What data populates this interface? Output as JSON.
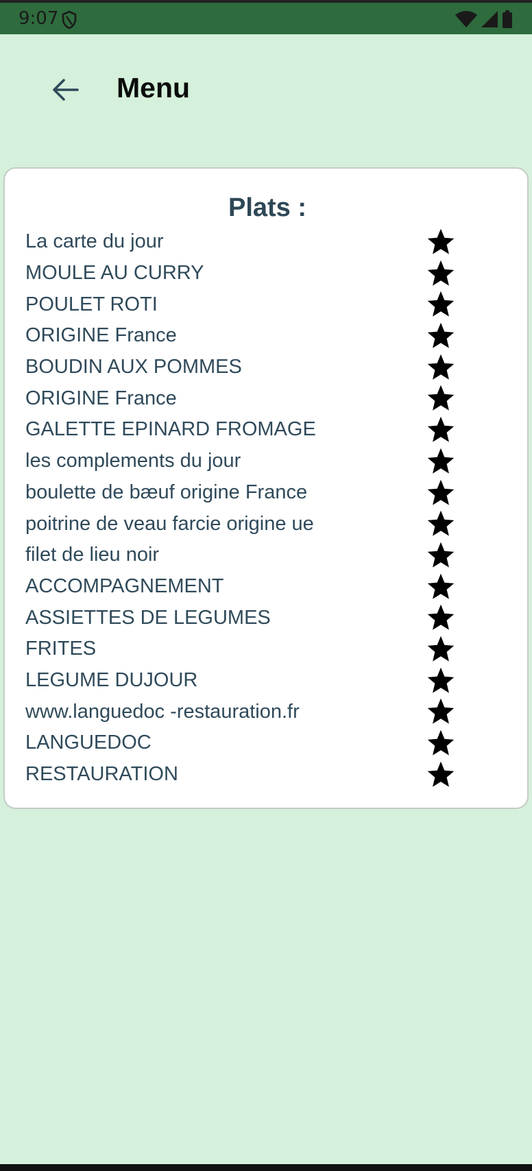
{
  "status_bar": {
    "time": "9:07",
    "icons": [
      "shield-icon",
      "wifi-icon",
      "cellular-signal-icon",
      "battery-icon"
    ]
  },
  "app_bar": {
    "back_icon": "arrow-back-icon",
    "title": "Menu"
  },
  "card": {
    "title": "Plats :",
    "items": [
      {
        "label": "La carte du jour"
      },
      {
        "label": "MOULE AU CURRY"
      },
      {
        "label": "POULET ROTI"
      },
      {
        "label": "ORIGINE France"
      },
      {
        "label": "BOUDIN AUX POMMES"
      },
      {
        "label": "ORIGINE France"
      },
      {
        "label": "GALETTE EPINARD FROMAGE"
      },
      {
        "label": "les complements du jour"
      },
      {
        "label": "boulette de bæuf origine France"
      },
      {
        "label": "poitrine de veau farcie origine ue"
      },
      {
        "label": "filet de lieu noir"
      },
      {
        "label": "ACCOMPAGNEMENT"
      },
      {
        "label": "ASSIETTES DE LEGUMES"
      },
      {
        "label": "FRITES"
      },
      {
        "label": "LEGUME DUJOUR"
      },
      {
        "label": "www.languedoc -restauration.fr"
      },
      {
        "label": "LANGUEDOC"
      },
      {
        "label": "RESTAURATION"
      }
    ],
    "star_icon": "star-icon"
  },
  "colors": {
    "background": "#d5f0db",
    "status_bar": "#2e6b3d",
    "card": "#ffffff",
    "item_text": "#2f4a5a",
    "title_text": "#2e4756"
  }
}
